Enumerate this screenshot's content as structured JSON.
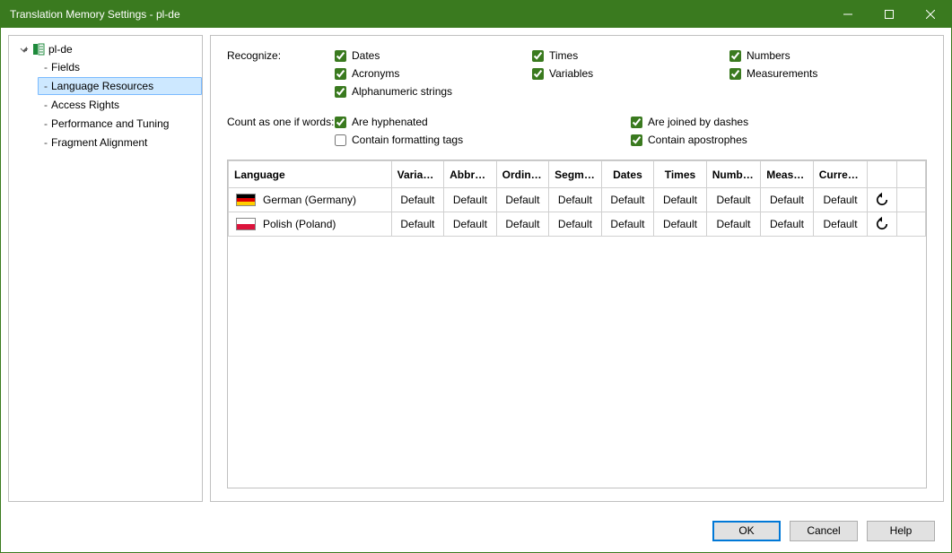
{
  "window": {
    "title": "Translation Memory Settings - pl-de"
  },
  "tree": {
    "root": "pl-de",
    "items": [
      {
        "label": "Fields",
        "selected": false
      },
      {
        "label": "Language Resources",
        "selected": true
      },
      {
        "label": "Access Rights",
        "selected": false
      },
      {
        "label": "Performance and Tuning",
        "selected": false
      },
      {
        "label": "Fragment Alignment",
        "selected": false
      }
    ]
  },
  "recognize": {
    "label": "Recognize:",
    "options": [
      {
        "label": "Dates",
        "checked": true
      },
      {
        "label": "Times",
        "checked": true
      },
      {
        "label": "Numbers",
        "checked": true
      },
      {
        "label": "Acronyms",
        "checked": true
      },
      {
        "label": "Variables",
        "checked": true
      },
      {
        "label": "Measurements",
        "checked": true
      },
      {
        "label": "Alphanumeric strings",
        "checked": true
      }
    ]
  },
  "count": {
    "label": "Count as one if words:",
    "options": [
      {
        "label": "Are hyphenated",
        "checked": true
      },
      {
        "label": "Are joined by dashes",
        "checked": true
      },
      {
        "label": "Contain formatting tags",
        "checked": false
      },
      {
        "label": "Contain apostrophes",
        "checked": true
      }
    ]
  },
  "table": {
    "headers": [
      "Language",
      "Variabl...",
      "Abbrev...",
      "Ordinal...",
      "Segme...",
      "Dates",
      "Times",
      "Numbers",
      "Measur...",
      "Currency"
    ],
    "rows": [
      {
        "flag": "de",
        "language": "German (Germany)",
        "values": [
          "Default",
          "Default",
          "Default",
          "Default",
          "Default",
          "Default",
          "Default",
          "Default",
          "Default"
        ]
      },
      {
        "flag": "pl",
        "language": "Polish (Poland)",
        "values": [
          "Default",
          "Default",
          "Default",
          "Default",
          "Default",
          "Default",
          "Default",
          "Default",
          "Default"
        ]
      }
    ]
  },
  "buttons": {
    "ok": "OK",
    "cancel": "Cancel",
    "help": "Help"
  }
}
